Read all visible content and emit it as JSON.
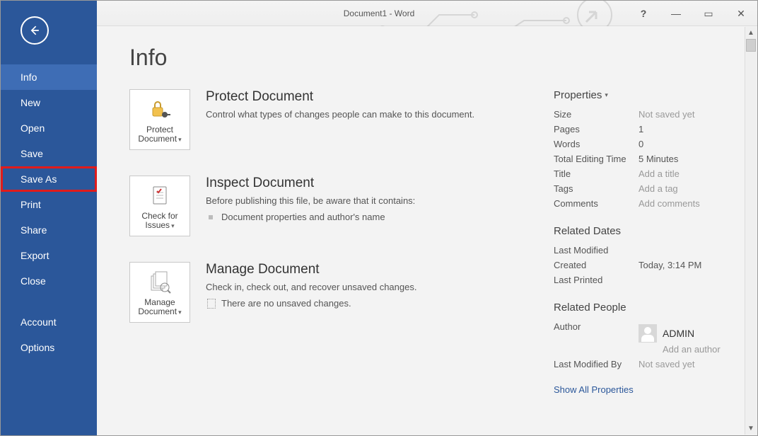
{
  "window": {
    "title": "Document1 - Word",
    "help_label": "?",
    "minimize_label": "—",
    "restore_label": "▭",
    "close_label": "✕"
  },
  "sidebar": {
    "items": [
      {
        "label": "Info",
        "selected": true
      },
      {
        "label": "New"
      },
      {
        "label": "Open"
      },
      {
        "label": "Save"
      },
      {
        "label": "Save As",
        "highlight": true
      },
      {
        "label": "Print"
      },
      {
        "label": "Share"
      },
      {
        "label": "Export"
      },
      {
        "label": "Close"
      }
    ],
    "footer": [
      {
        "label": "Account"
      },
      {
        "label": "Options"
      }
    ]
  },
  "page": {
    "title": "Info",
    "blocks": {
      "protect": {
        "tile_line1": "Protect",
        "tile_line2": "Document",
        "heading": "Protect Document",
        "desc": "Control what types of changes people can make to this document."
      },
      "inspect": {
        "tile_line1": "Check for",
        "tile_line2": "Issues",
        "heading": "Inspect Document",
        "desc": "Before publishing this file, be aware that it contains:",
        "item1": "Document properties and author's name"
      },
      "manage": {
        "tile_line1": "Manage",
        "tile_line2": "Document",
        "heading": "Manage Document",
        "desc": "Check in, check out, and recover unsaved changes.",
        "item1": "There are no unsaved changes."
      }
    }
  },
  "properties": {
    "heading": "Properties",
    "rows": {
      "size": {
        "k": "Size",
        "v": "Not saved yet"
      },
      "pages": {
        "k": "Pages",
        "v": "1"
      },
      "words": {
        "k": "Words",
        "v": "0"
      },
      "editing": {
        "k": "Total Editing Time",
        "v": "5 Minutes"
      },
      "title": {
        "k": "Title",
        "v": "Add a title",
        "placeholder": true
      },
      "tags": {
        "k": "Tags",
        "v": "Add a tag",
        "placeholder": true
      },
      "comments": {
        "k": "Comments",
        "v": "Add comments",
        "placeholder": true
      }
    },
    "related_dates": {
      "heading": "Related Dates",
      "last_modified": {
        "k": "Last Modified",
        "v": ""
      },
      "created": {
        "k": "Created",
        "v": "Today, 3:14 PM"
      },
      "last_printed": {
        "k": "Last Printed",
        "v": ""
      }
    },
    "related_people": {
      "heading": "Related People",
      "author_label": "Author",
      "author_name": "ADMIN",
      "add_author": "Add an author",
      "last_modified_by": {
        "k": "Last Modified By",
        "v": "Not saved yet"
      }
    },
    "show_all": "Show All Properties"
  }
}
